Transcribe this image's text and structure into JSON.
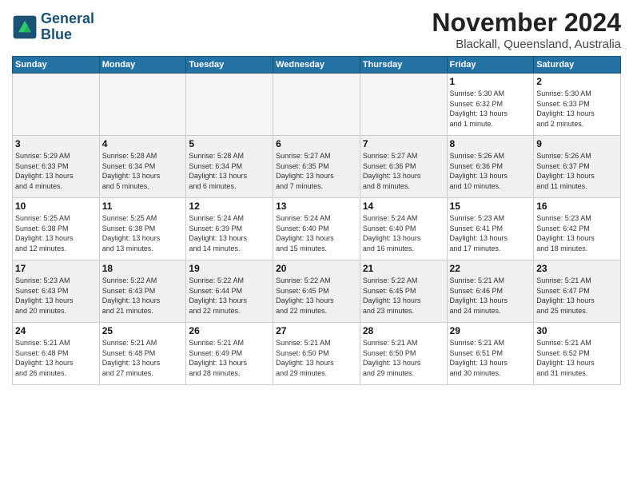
{
  "header": {
    "title": "November 2024",
    "location": "Blackall, Queensland, Australia",
    "logo_line1": "General",
    "logo_line2": "Blue"
  },
  "weekdays": [
    "Sunday",
    "Monday",
    "Tuesday",
    "Wednesday",
    "Thursday",
    "Friday",
    "Saturday"
  ],
  "weeks": [
    [
      {
        "day": "",
        "info": "",
        "empty": true
      },
      {
        "day": "",
        "info": "",
        "empty": true
      },
      {
        "day": "",
        "info": "",
        "empty": true
      },
      {
        "day": "",
        "info": "",
        "empty": true
      },
      {
        "day": "",
        "info": "",
        "empty": true
      },
      {
        "day": "1",
        "info": "Sunrise: 5:30 AM\nSunset: 6:32 PM\nDaylight: 13 hours\nand 1 minute."
      },
      {
        "day": "2",
        "info": "Sunrise: 5:30 AM\nSunset: 6:33 PM\nDaylight: 13 hours\nand 2 minutes."
      }
    ],
    [
      {
        "day": "3",
        "info": "Sunrise: 5:29 AM\nSunset: 6:33 PM\nDaylight: 13 hours\nand 4 minutes."
      },
      {
        "day": "4",
        "info": "Sunrise: 5:28 AM\nSunset: 6:34 PM\nDaylight: 13 hours\nand 5 minutes."
      },
      {
        "day": "5",
        "info": "Sunrise: 5:28 AM\nSunset: 6:34 PM\nDaylight: 13 hours\nand 6 minutes."
      },
      {
        "day": "6",
        "info": "Sunrise: 5:27 AM\nSunset: 6:35 PM\nDaylight: 13 hours\nand 7 minutes."
      },
      {
        "day": "7",
        "info": "Sunrise: 5:27 AM\nSunset: 6:36 PM\nDaylight: 13 hours\nand 8 minutes."
      },
      {
        "day": "8",
        "info": "Sunrise: 5:26 AM\nSunset: 6:36 PM\nDaylight: 13 hours\nand 10 minutes."
      },
      {
        "day": "9",
        "info": "Sunrise: 5:26 AM\nSunset: 6:37 PM\nDaylight: 13 hours\nand 11 minutes."
      }
    ],
    [
      {
        "day": "10",
        "info": "Sunrise: 5:25 AM\nSunset: 6:38 PM\nDaylight: 13 hours\nand 12 minutes."
      },
      {
        "day": "11",
        "info": "Sunrise: 5:25 AM\nSunset: 6:38 PM\nDaylight: 13 hours\nand 13 minutes."
      },
      {
        "day": "12",
        "info": "Sunrise: 5:24 AM\nSunset: 6:39 PM\nDaylight: 13 hours\nand 14 minutes."
      },
      {
        "day": "13",
        "info": "Sunrise: 5:24 AM\nSunset: 6:40 PM\nDaylight: 13 hours\nand 15 minutes."
      },
      {
        "day": "14",
        "info": "Sunrise: 5:24 AM\nSunset: 6:40 PM\nDaylight: 13 hours\nand 16 minutes."
      },
      {
        "day": "15",
        "info": "Sunrise: 5:23 AM\nSunset: 6:41 PM\nDaylight: 13 hours\nand 17 minutes."
      },
      {
        "day": "16",
        "info": "Sunrise: 5:23 AM\nSunset: 6:42 PM\nDaylight: 13 hours\nand 18 minutes."
      }
    ],
    [
      {
        "day": "17",
        "info": "Sunrise: 5:23 AM\nSunset: 6:43 PM\nDaylight: 13 hours\nand 20 minutes."
      },
      {
        "day": "18",
        "info": "Sunrise: 5:22 AM\nSunset: 6:43 PM\nDaylight: 13 hours\nand 21 minutes."
      },
      {
        "day": "19",
        "info": "Sunrise: 5:22 AM\nSunset: 6:44 PM\nDaylight: 13 hours\nand 22 minutes."
      },
      {
        "day": "20",
        "info": "Sunrise: 5:22 AM\nSunset: 6:45 PM\nDaylight: 13 hours\nand 22 minutes."
      },
      {
        "day": "21",
        "info": "Sunrise: 5:22 AM\nSunset: 6:45 PM\nDaylight: 13 hours\nand 23 minutes."
      },
      {
        "day": "22",
        "info": "Sunrise: 5:21 AM\nSunset: 6:46 PM\nDaylight: 13 hours\nand 24 minutes."
      },
      {
        "day": "23",
        "info": "Sunrise: 5:21 AM\nSunset: 6:47 PM\nDaylight: 13 hours\nand 25 minutes."
      }
    ],
    [
      {
        "day": "24",
        "info": "Sunrise: 5:21 AM\nSunset: 6:48 PM\nDaylight: 13 hours\nand 26 minutes."
      },
      {
        "day": "25",
        "info": "Sunrise: 5:21 AM\nSunset: 6:48 PM\nDaylight: 13 hours\nand 27 minutes."
      },
      {
        "day": "26",
        "info": "Sunrise: 5:21 AM\nSunset: 6:49 PM\nDaylight: 13 hours\nand 28 minutes."
      },
      {
        "day": "27",
        "info": "Sunrise: 5:21 AM\nSunset: 6:50 PM\nDaylight: 13 hours\nand 29 minutes."
      },
      {
        "day": "28",
        "info": "Sunrise: 5:21 AM\nSunset: 6:50 PM\nDaylight: 13 hours\nand 29 minutes."
      },
      {
        "day": "29",
        "info": "Sunrise: 5:21 AM\nSunset: 6:51 PM\nDaylight: 13 hours\nand 30 minutes."
      },
      {
        "day": "30",
        "info": "Sunrise: 5:21 AM\nSunset: 6:52 PM\nDaylight: 13 hours\nand 31 minutes."
      }
    ]
  ]
}
